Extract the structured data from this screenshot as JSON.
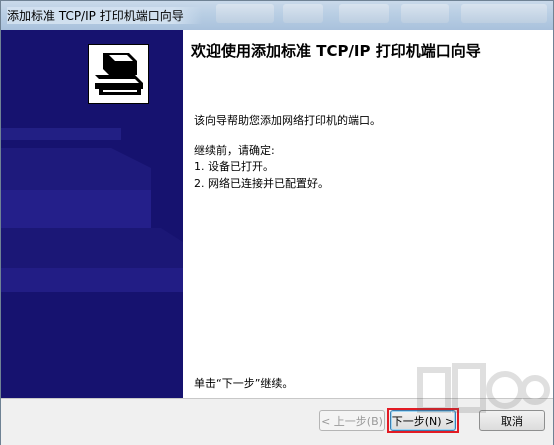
{
  "window": {
    "title": "添加标准 TCP/IP 打印机端口向导"
  },
  "main": {
    "heading": "欢迎使用添加标准 TCP/IP 打印机端口向导",
    "intro": "该向导帮助您添加网络打印机的端口。",
    "before_label": "继续前，请确定:",
    "requirements": [
      "1.  设备已打开。",
      "2.  网络已连接并已配置好。"
    ],
    "hint": "单击“下一步”继续。"
  },
  "buttons": {
    "back": "< 上一步(B)",
    "next": "下一步(N) >",
    "cancel": "取消"
  },
  "colors": {
    "sidebar": "#16126f",
    "highlight": "#e21b24"
  }
}
